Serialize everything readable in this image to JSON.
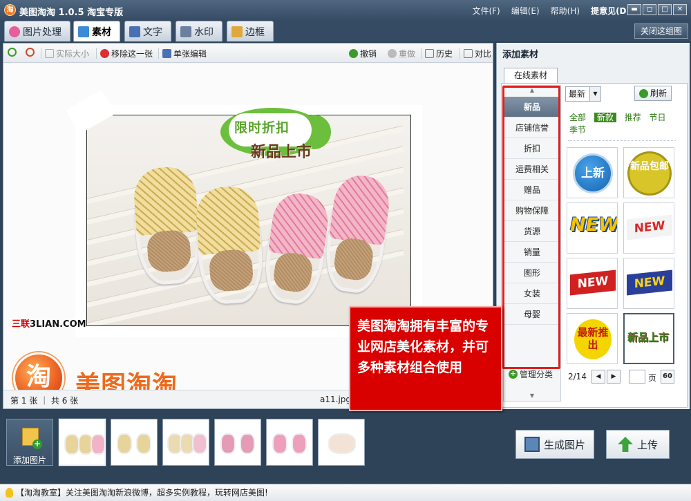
{
  "app": {
    "logo_char": "淘",
    "title": "美图淘淘 1.0.5 淘宝专版",
    "menu": [
      "文件(F)",
      "编辑(E)",
      "帮助(H)"
    ],
    "feedback": "提意见(D)",
    "window_buttons": [
      "▬",
      "◻",
      "□",
      "✕"
    ]
  },
  "tabs": [
    {
      "label": "图片处理",
      "icon": "image-edit-icon",
      "color": "#e85d9a"
    },
    {
      "label": "素材",
      "icon": "material-icon",
      "color": "#3c8ad8"
    },
    {
      "label": "文字",
      "icon": "text-icon",
      "color": "#4a6fb3"
    },
    {
      "label": "水印",
      "icon": "watermark-icon",
      "color": "#6b7fa0"
    },
    {
      "label": "边框",
      "icon": "border-icon",
      "color": "#e0a83a"
    }
  ],
  "close_group_label": "关闭这组图",
  "toolbar": {
    "actual_size": "实际大小",
    "remove_one": "移除这一张",
    "single_edit": "单张编辑",
    "undo": "撤销",
    "redo": "重做",
    "history": "历史",
    "compare": "对比"
  },
  "canvas": {
    "sticker_line1": "限时折扣",
    "sticker_line2": "新品上市",
    "watermark_3lian_red": "三联",
    "watermark_3lian_black": "3LIAN.COM",
    "logo_char": "淘",
    "brand_text": "美图淘淘"
  },
  "status": {
    "page_info": "第 1 张 ｜ 共 6 张",
    "filename": "a11.jpg"
  },
  "panel": {
    "title": "添加素材",
    "tab": "在线素材",
    "categories": [
      "新品",
      "店铺信誉",
      "折扣",
      "运费相关",
      "赠品",
      "购物保障",
      "货源",
      "销量",
      "图形",
      "女装",
      "母婴"
    ],
    "manage_label": "管理分类",
    "sort_value": "最新",
    "refresh_label": "刷新",
    "subcats": [
      "全部",
      "新款",
      "推荐",
      "节日",
      "季节"
    ],
    "materials": {
      "shangxin": "上新",
      "baoyou": "新品包邮",
      "new": "NEW",
      "hot": "最新推出",
      "xinpin": "新品上市"
    },
    "pager": {
      "count": "2/14",
      "page_suffix": "页",
      "go": "60"
    }
  },
  "callout_text": "美图淘淘拥有丰富的专业网店美化素材，并可多种素材组合使用",
  "bottom": {
    "add_label": "添加图片",
    "generate_label": "生成图片",
    "upload_label": "上传"
  },
  "footer_text": "【淘淘教室】关注美图淘淘新浪微博，超多实例教程，玩转网店美图!"
}
